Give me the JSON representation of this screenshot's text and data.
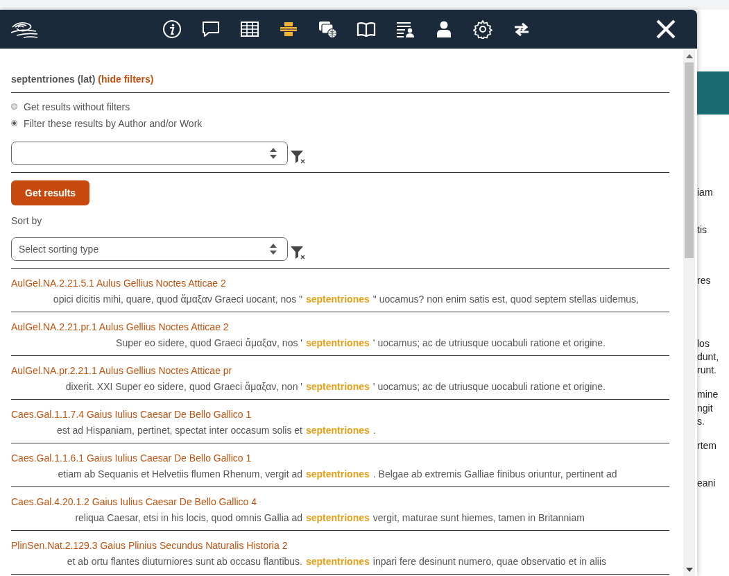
{
  "toolbar": {
    "tools": [
      {
        "kind": "info",
        "selected": false
      },
      {
        "kind": "comment",
        "selected": false
      },
      {
        "kind": "table",
        "selected": false
      },
      {
        "kind": "search",
        "selected": true
      },
      {
        "kind": "windows",
        "selected": false
      },
      {
        "kind": "book",
        "selected": false
      },
      {
        "kind": "list",
        "selected": false
      },
      {
        "kind": "user",
        "selected": false
      },
      {
        "kind": "settings",
        "selected": false
      },
      {
        "kind": "swap",
        "selected": false
      }
    ]
  },
  "filters": {
    "query": "septentriones (lat)",
    "toggle_link": "(hide filters)",
    "options": [
      {
        "label": "Get results without filters",
        "selected": false
      },
      {
        "label": "Filter these results by Author and/or Work",
        "selected": true
      }
    ],
    "submit_button": "Get results",
    "sort_label": "Sort by",
    "sort_select": {
      "placeholder": "Select sorting type"
    }
  },
  "results": [
    {
      "reference": "AulGel.NA.2.21.5.1 Aulus Gellius Noctes Atticae 2",
      "before": "opici dicitis mihi, quare, quod ἅμαξαν Graeci uocant, nos \"",
      "keyword": "septentriones",
      "after": "\" uocamus? non enim satis est, quod septem stellas uidemus,"
    },
    {
      "reference": "AulGel.NA.2.21.pr.1 Aulus Gellius Noctes Atticae 2",
      "before": "Super eo sidere, quod Graeci ἅμαξαν, nos '",
      "keyword": "septentriones",
      "after": "' uocamus; ac de utriusque uocabuli ratione et origine."
    },
    {
      "reference": "AulGel.NA.pr.2.21.1 Aulus Gellius Noctes Atticae pr",
      "before": "dixerit. XXI Super eo sidere, quod Graeci ἅμαξαν, non '",
      "keyword": "septentriones",
      "after": "' uocamus; ac de utriusque uocabuli ratione et origine."
    },
    {
      "reference": "Caes.Gal.1.1.7.4 Gaius Iulius Caesar De Bello Gallico 1",
      "before": "est ad Hispaniam, pertinet, spectat inter occasum solis et",
      "keyword": "septentriones",
      "after": "."
    },
    {
      "reference": "Caes.Gal.1.1.6.1 Gaius Iulius Caesar De Bello Gallico 1",
      "before": "etiam ab Sequanis et Helvetiis flumen Rhenum, vergit ad",
      "keyword": "septentriones",
      "after": ". Belgae ab extremis Galliae finibus oriuntur, pertinent ad"
    },
    {
      "reference": "Caes.Gal.4.20.1.2 Gaius Iulius Caesar De Bello Gallico 4",
      "before": "reliqua Caesar, etsi in his locis, quod omnis Gallia ad",
      "keyword": "septentriones",
      "after": "vergit, maturae sunt hiemes, tamen in Britanniam"
    },
    {
      "reference": "PlinSen.Nat.2.129.3 Gaius Plinius Secundus Naturalis Historia 2",
      "before": "et ab ortu flantes diuturniores sunt ab occasu flantibus.",
      "keyword": "septentriones",
      "after": "inpari fere desinunt numero, quae observatio et in aliis"
    }
  ],
  "background_fragments": [
    "iam",
    "tis",
    "res",
    "los",
    "dunt,",
    "runt.",
    "mine",
    "ngit",
    "s.",
    "rtem",
    "eani"
  ]
}
